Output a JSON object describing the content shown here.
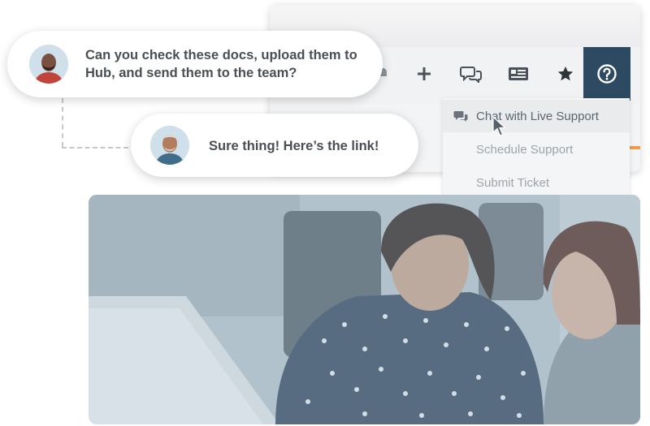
{
  "conversation": {
    "messages": [
      {
        "text": "Can you check these docs, upload them to Hub, and send them to the team?"
      },
      {
        "text": "Sure thing! Here’s the link!"
      }
    ]
  },
  "app": {
    "toolbar": {
      "icons": [
        "partial-icon",
        "plus-icon",
        "chat-bubbles-icon",
        "newspaper-icon",
        "star-icon",
        "help-icon"
      ]
    },
    "help_menu": {
      "items": [
        {
          "label": "Chat with Live Support",
          "icon": "chat-bubbles-icon",
          "state": "hovered"
        },
        {
          "label": "Schedule Support"
        },
        {
          "label": "Submit Ticket"
        }
      ]
    }
  },
  "colors": {
    "help_button": "#2e4a62",
    "accent_line": "#f39a4a",
    "photo_overlay": "#9fb6c6"
  }
}
